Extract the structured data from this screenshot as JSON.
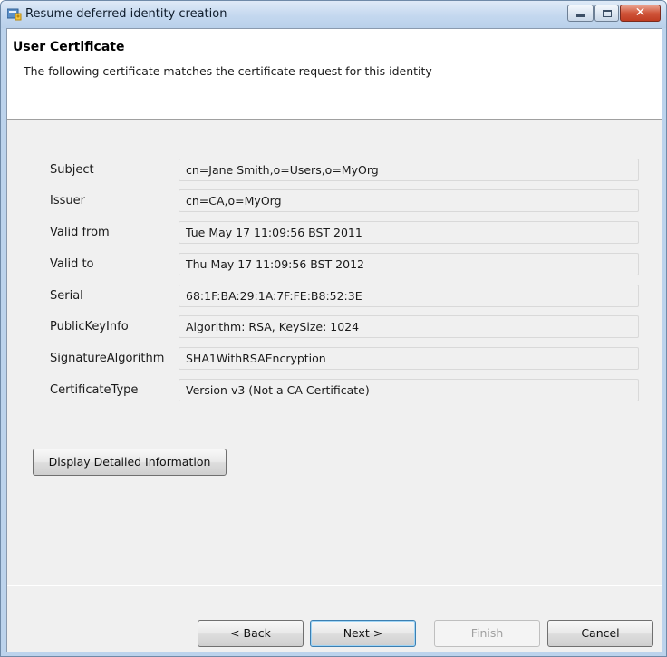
{
  "window": {
    "title": "Resume deferred identity creation",
    "icon": "certificate-wizard-icon",
    "controls": {
      "minimize": "minimize-icon",
      "maximize": "maximize-icon",
      "close_glyph": "✕"
    }
  },
  "header": {
    "title": "User Certificate",
    "description": "The following certificate matches the certificate request for this identity"
  },
  "fields": [
    {
      "label": "Subject",
      "value": "cn=Jane Smith,o=Users,o=MyOrg"
    },
    {
      "label": "Issuer",
      "value": "cn=CA,o=MyOrg"
    },
    {
      "label": "Valid from",
      "value": "Tue May 17 11:09:56 BST 2011"
    },
    {
      "label": "Valid to",
      "value": "Thu May 17 11:09:56 BST 2012"
    },
    {
      "label": "Serial",
      "value": "68:1F:BA:29:1A:7F:FE:B8:52:3E"
    },
    {
      "label": "PublicKeyInfo",
      "value": "Algorithm: RSA, KeySize: 1024"
    },
    {
      "label": "SignatureAlgorithm",
      "value": "SHA1WithRSAEncryption"
    },
    {
      "label": "CertificateType",
      "value": "Version v3 (Not a CA Certificate)"
    }
  ],
  "buttons": {
    "details": "Display Detailed Information",
    "back": "< Back",
    "next": "Next >",
    "finish": "Finish",
    "cancel": "Cancel"
  },
  "colors": {
    "title_bar": "#c4d8ef",
    "close_button": "#d0553a",
    "dialog_background": "#f0f0f0",
    "primary_button_border": "#3c7fb1"
  }
}
